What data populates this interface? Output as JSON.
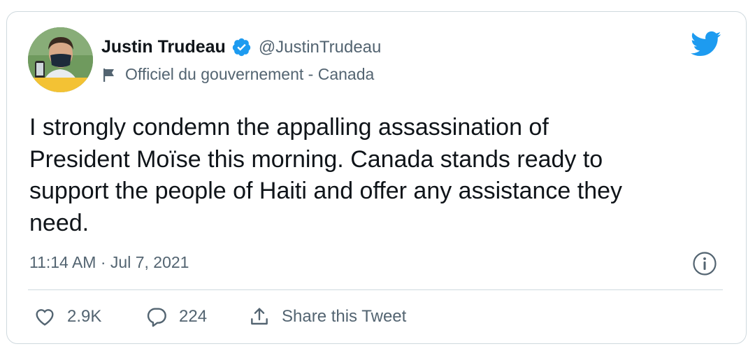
{
  "tweet": {
    "author": {
      "name": "Justin Trudeau",
      "handle": "@JustinTrudeau",
      "label": "Officiel du gouvernement - Canada",
      "verified": true,
      "avatar_icon": "avatar-photo"
    },
    "text_lines": [
      "I strongly condemn the appalling assassination of",
      "President Moïse this morning. Canada stands ready to",
      "support the people of Haiti and offer any assistance they",
      "need."
    ],
    "timestamp": "11:14 AM · Jul 7, 2021",
    "actions": {
      "likes": {
        "icon": "heart-icon",
        "count": "2.9K"
      },
      "replies": {
        "icon": "reply-icon",
        "count": "224"
      },
      "share": {
        "icon": "share-icon",
        "label": "Share this Tweet"
      }
    },
    "colors": {
      "brand": "#1d9bf0",
      "text": "#0f1419",
      "secondary": "#536471",
      "border": "#cfd9de"
    }
  }
}
